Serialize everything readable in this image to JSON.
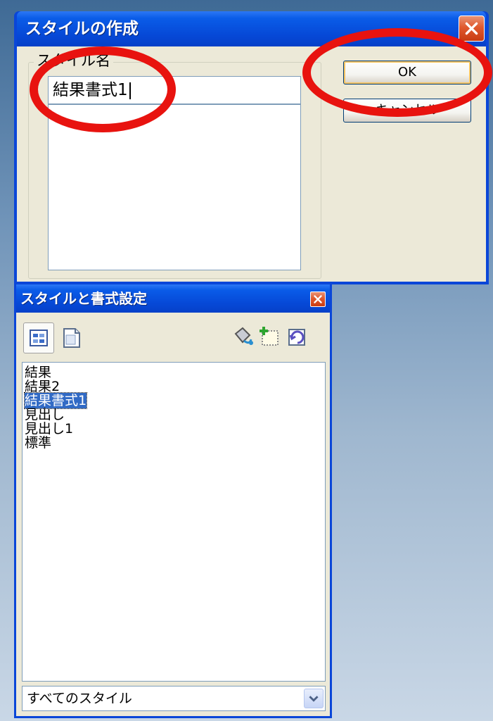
{
  "create_dialog": {
    "title": "スタイルの作成",
    "group_label": "スタイル名",
    "style_name_value": "結果書式1",
    "ok_label": "OK",
    "cancel_label": "キャンセル"
  },
  "styles_panel": {
    "title": "スタイルと書式設定",
    "items": [
      {
        "label": "結果"
      },
      {
        "label": "結果2"
      },
      {
        "label": "結果書式1",
        "selected": true
      },
      {
        "label": "見出し"
      },
      {
        "label": "見出し1"
      },
      {
        "label": "標準"
      }
    ],
    "filter_value": "すべてのスタイル"
  },
  "colors": {
    "titlebar": "#0648d6",
    "close_button": "#e0592e",
    "dialog_face": "#ece9d8",
    "selection": "#316ac5",
    "annotation": "#e8130f"
  },
  "icons": {
    "close": "close-icon",
    "paragraph_styles": "paragraph-styles-icon",
    "page_styles": "page-styles-icon",
    "fill_format": "fill-format-icon",
    "new_style": "new-style-icon",
    "update_style": "update-style-icon",
    "dropdown": "chevron-down-icon"
  }
}
